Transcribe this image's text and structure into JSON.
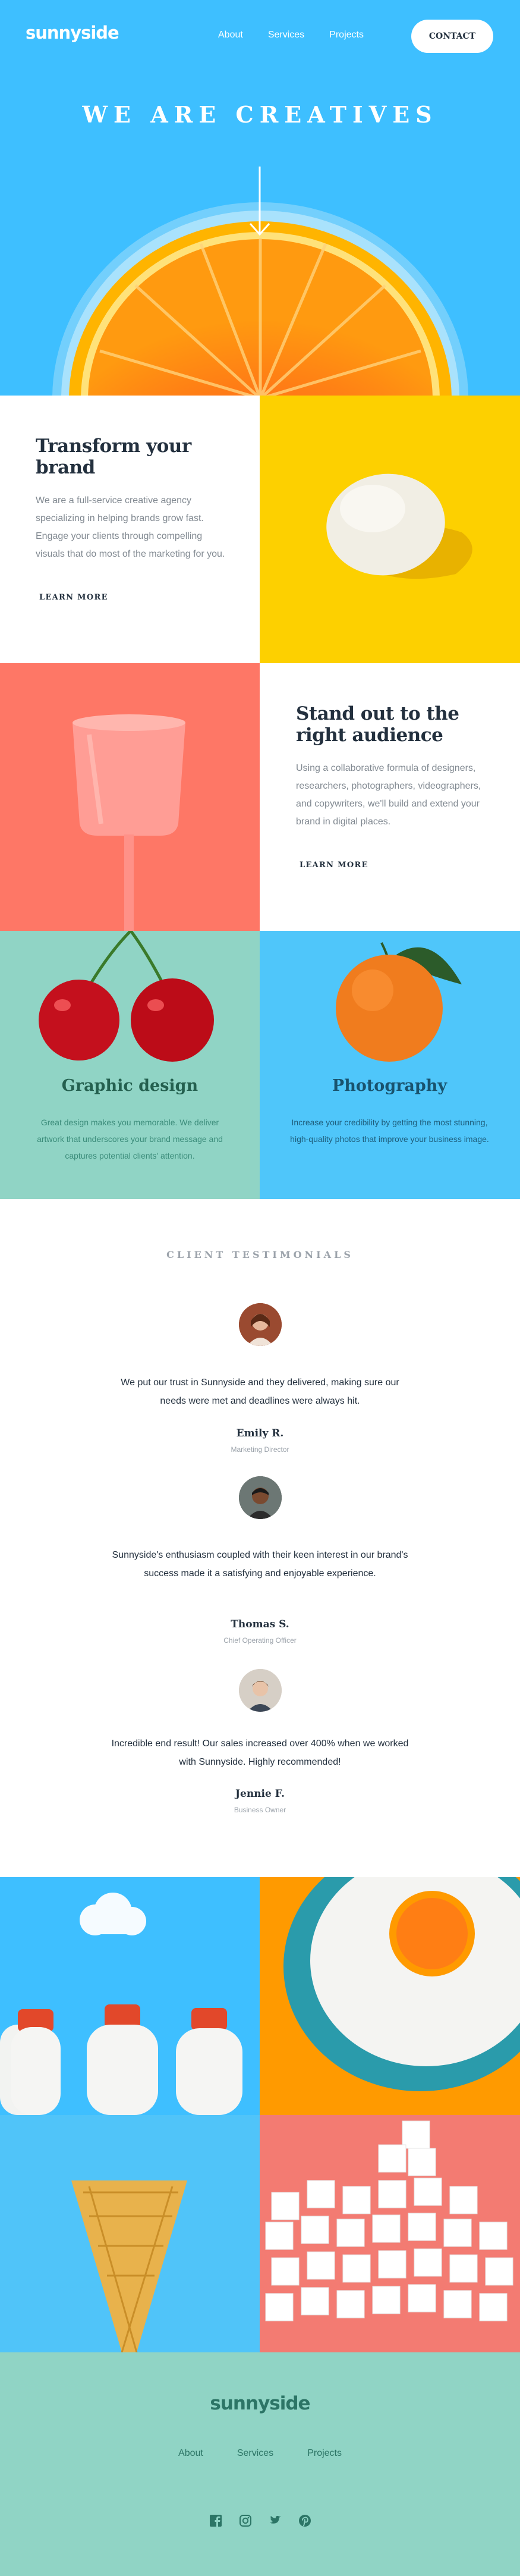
{
  "header": {
    "logo": "sunnyside",
    "nav": [
      "About",
      "Services",
      "Projects"
    ],
    "contact_label": "CONTACT"
  },
  "hero": {
    "title": "WE ARE CREATIVES",
    "arrow_icon": "arrow-down-icon"
  },
  "features": [
    {
      "title": "Transform your brand",
      "text": "We are a full-service creative agency specializing in helping brands grow fast. Engage your clients through compelling visuals that do most of the marketing for you.",
      "link_label": "LEARN MORE",
      "accent": "#fad400"
    },
    {
      "title": "Stand out to the right audience",
      "text": "Using a collaborative formula of designers, researchers, photographers, videographers, and copywriters, we'll build and extend your brand in digital places.",
      "link_label": "LEARN MORE",
      "accent": "#fe7766"
    }
  ],
  "services": [
    {
      "title": "Graphic design",
      "text": "Great design makes you memorable. We deliver artwork that underscores your brand message and captures potential clients' attention.",
      "bg": "#90d4c5",
      "title_color": "#24604f",
      "text_color": "#3b8c7a"
    },
    {
      "title": "Photography",
      "text": "Increase your credibility by getting the most stunning, high-quality photos that improve your business image.",
      "bg": "#4fc6fa",
      "title_color": "#19536e",
      "text_color": "#1e5d7b"
    }
  ],
  "testimonials": {
    "heading": "CLIENT TESTIMONIALS",
    "items": [
      {
        "quote": "We put our trust in Sunnyside and they delivered, making sure our needs were met and deadlines were always hit.",
        "name": "Emily R.",
        "role": "Marketing Director"
      },
      {
        "quote": "Sunnyside's enthusiasm coupled with their keen interest in our brand's success made it a satisfying and enjoyable experience.",
        "name": "Thomas S.",
        "role": "Chief Operating Officer"
      },
      {
        "quote": "Incredible end result! Our sales increased over 400% when we worked with Sunnyside. Highly recommended!",
        "name": "Jennie F.",
        "role": "Business Owner"
      }
    ]
  },
  "footer": {
    "logo": "sunnyside",
    "nav": [
      "About",
      "Services",
      "Projects"
    ],
    "socials": [
      "facebook-icon",
      "instagram-icon",
      "twitter-icon",
      "pinterest-icon"
    ]
  },
  "colors": {
    "hero_bg": "#3ebfff",
    "egg_tile": "#fdd000",
    "cup_tile": "#fe7766",
    "footer_bg": "#90d4c5",
    "footer_text": "#2c7566",
    "dark_text": "#23303e"
  }
}
